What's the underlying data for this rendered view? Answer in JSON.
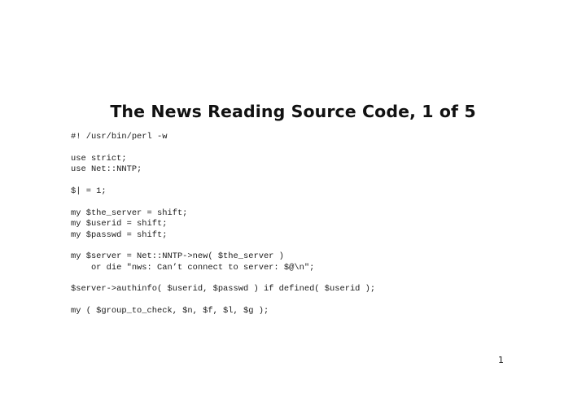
{
  "slide": {
    "title": "The News Reading Source Code, 1 of 5",
    "code_lines": [
      "#! /usr/bin/perl -w",
      "",
      "use strict;",
      "use Net::NNTP;",
      "",
      "$| = 1;",
      "",
      "my $the_server = shift;",
      "my $userid = shift;",
      "my $passwd = shift;",
      "",
      "my $server = Net::NNTP->new( $the_server )",
      "    or die \"nws: Can’t connect to server: $@\\n\";",
      "",
      "$server->authinfo( $userid, $passwd ) if defined( $userid );",
      "",
      "my ( $group_to_check, $n, $f, $l, $g );"
    ],
    "page_number": "1"
  }
}
